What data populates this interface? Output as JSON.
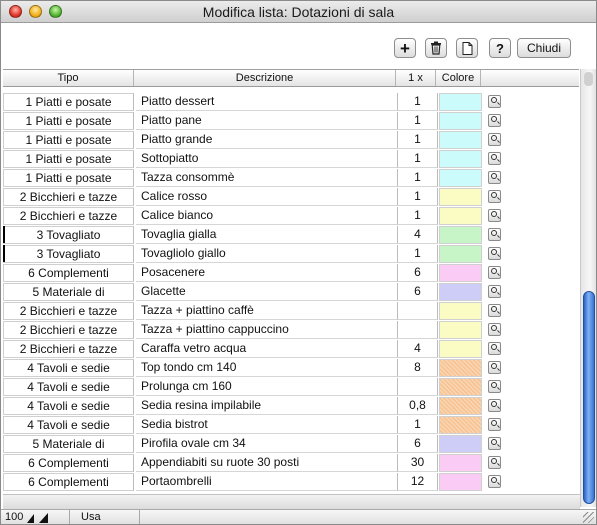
{
  "window": {
    "title": "Modifica lista: Dotazioni di sala"
  },
  "toolbar": {
    "add_label": "+",
    "help_label": "?",
    "close_label": "Chiudi",
    "icons": {
      "trash": "trash-icon",
      "doc": "document-icon"
    }
  },
  "table": {
    "headers": {
      "tipo": "Tipo",
      "descrizione": "Descrizione",
      "qty": "1 x",
      "colore": "Colore"
    },
    "rows": [
      {
        "tipo": "1 Piatti e posate",
        "desc": "Piatto dessert",
        "qty": "1",
        "color": "#ccfbfb",
        "hatch": false,
        "marked": false
      },
      {
        "tipo": "1 Piatti e posate",
        "desc": "Piatto pane",
        "qty": "1",
        "color": "#ccfbfb",
        "hatch": false,
        "marked": false
      },
      {
        "tipo": "1 Piatti e posate",
        "desc": "Piatto grande",
        "qty": "1",
        "color": "#ccfbfb",
        "hatch": false,
        "marked": false
      },
      {
        "tipo": "1 Piatti e posate",
        "desc": "Sottopiatto",
        "qty": "1",
        "color": "#ccfbfb",
        "hatch": false,
        "marked": false
      },
      {
        "tipo": "1 Piatti e posate",
        "desc": "Tazza consommè",
        "qty": "1",
        "color": "#ccfbfb",
        "hatch": false,
        "marked": false
      },
      {
        "tipo": "2 Bicchieri e tazze",
        "desc": "Calice rosso",
        "qty": "1",
        "color": "#fbfbc4",
        "hatch": false,
        "marked": false
      },
      {
        "tipo": "2 Bicchieri e tazze",
        "desc": "Calice bianco",
        "qty": "1",
        "color": "#fbfbc4",
        "hatch": false,
        "marked": false
      },
      {
        "tipo": "3 Tovagliato",
        "desc": "Tovaglia gialla",
        "qty": "4",
        "color": "#c8f5c8",
        "hatch": false,
        "marked": true
      },
      {
        "tipo": "3 Tovagliato",
        "desc": "Tovagliolo giallo",
        "qty": "1",
        "color": "#c8f5c8",
        "hatch": false,
        "marked": true
      },
      {
        "tipo": "6 Complementi",
        "desc": "Posacenere",
        "qty": "6",
        "color": "#f9cbf5",
        "hatch": false,
        "marked": false
      },
      {
        "tipo": "5 Materiale di",
        "desc": "Glacette",
        "qty": "6",
        "color": "#cdcdf7",
        "hatch": false,
        "marked": false
      },
      {
        "tipo": "2 Bicchieri e tazze",
        "desc": "Tazza + piattino caffè",
        "qty": "",
        "color": "#fbfbc4",
        "hatch": false,
        "marked": false
      },
      {
        "tipo": "2 Bicchieri e tazze",
        "desc": "Tazza + piattino cappuccino",
        "qty": "",
        "color": "#fbfbc4",
        "hatch": false,
        "marked": false
      },
      {
        "tipo": "2 Bicchieri e tazze",
        "desc": "Caraffa vetro acqua",
        "qty": "4",
        "color": "#fbfbc4",
        "hatch": false,
        "marked": false
      },
      {
        "tipo": "4 Tavoli e sedie",
        "desc": "Top tondo cm 140",
        "qty": "8",
        "color": "#f7c595",
        "hatch": true,
        "marked": false
      },
      {
        "tipo": "4 Tavoli e sedie",
        "desc": "Prolunga cm 160",
        "qty": "",
        "color": "#f7c595",
        "hatch": true,
        "marked": false
      },
      {
        "tipo": "4 Tavoli e sedie",
        "desc": "Sedia resina impilabile",
        "qty": "0,8",
        "color": "#f7c595",
        "hatch": true,
        "marked": false
      },
      {
        "tipo": "4 Tavoli e sedie",
        "desc": "Sedia bistrot",
        "qty": "1",
        "color": "#f7c595",
        "hatch": true,
        "marked": false
      },
      {
        "tipo": "5 Materiale di",
        "desc": "Pirofila ovale cm 34",
        "qty": "6",
        "color": "#cdcdf7",
        "hatch": false,
        "marked": false
      },
      {
        "tipo": "6 Complementi",
        "desc": "Appendiabiti su ruote 30 posti",
        "qty": "30",
        "color": "#f9cbf5",
        "hatch": false,
        "marked": false
      },
      {
        "tipo": "6 Complementi",
        "desc": "Portaombrelli",
        "qty": "12",
        "color": "#f9cbf5",
        "hatch": false,
        "marked": false
      }
    ]
  },
  "statusbar": {
    "zoom": "100",
    "mode": "Usa"
  }
}
